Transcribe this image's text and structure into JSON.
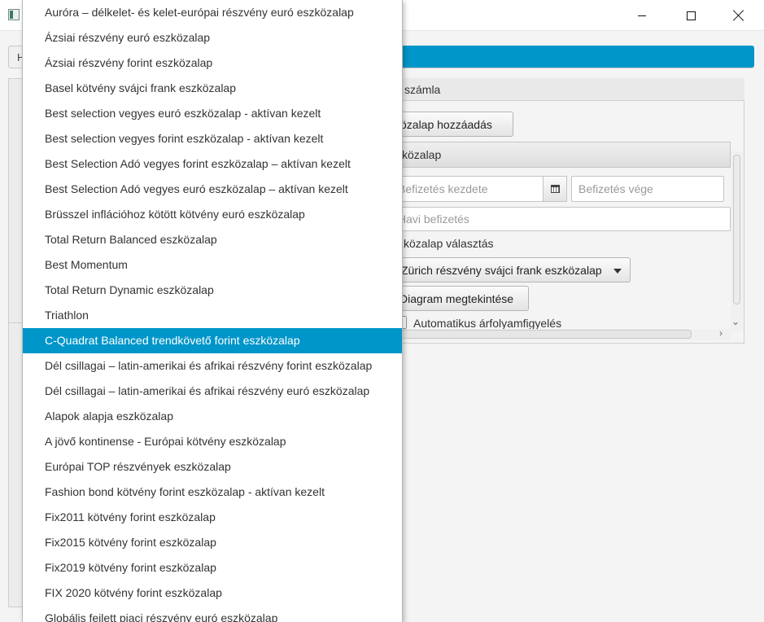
{
  "window": {
    "controls": {
      "minimize": "minimize-icon",
      "maximize": "maximize-icon",
      "close": "close-icon"
    }
  },
  "background": {
    "header_partial": "H",
    "tab_label": "számla",
    "add_fund_button": "közalap hozzáadás",
    "titled_pane": "zközalap",
    "payment_start_placeholder": "Befizetés kezdete",
    "payment_end_placeholder": "Befizetés vége",
    "monthly_payment_placeholder": "Havi befizetés",
    "fund_select_label": "zközalap választás",
    "fund_select_value": "Zürich részvény svájci frank eszközalap",
    "diagram_button": "Diagram megtekintése",
    "auto_watch_label": "Automatikus árfolyamfigyelés"
  },
  "colors": {
    "accent": "#0096c9"
  },
  "dropdown": {
    "selected_index": 13,
    "items": [
      "Auróra – délkelet- és kelet-európai részvény euró eszközalap",
      "Ázsiai részvény euró eszközalap",
      "Ázsiai részvény forint eszközalap",
      "Basel kötvény svájci frank eszközalap",
      "Best selection vegyes euró eszközalap - aktívan kezelt",
      "Best selection vegyes forint eszközalap - aktívan kezelt",
      "Best Selection Adó vegyes forint eszközalap – aktívan kezelt",
      "Best Selection Adó vegyes euró eszközalap – aktívan kezelt",
      "Brüsszel inflációhoz kötött kötvény euró eszközalap",
      "Total Return Balanced eszközalap",
      "Best Momentum",
      "Total Return Dynamic eszközalap",
      "Triathlon",
      "C-Quadrat Balanced trendkövető forint eszközalap",
      "Dél csillagai – latin-amerikai és afrikai részvény forint eszközalap",
      "Dél csillagai – latin-amerikai és afrikai részvény euró eszközalap",
      "Alapok alapja eszközalap",
      "A jövő kontinense - Európai kötvény eszközalap",
      "Európai TOP részvények eszközalap",
      "Fashion bond kötvény forint eszközalap - aktívan kezelt",
      "Fix2011 kötvény forint eszközalap",
      "Fix2015 kötvény forint eszközalap",
      "Fix2019 kötvény forint eszközalap",
      "FIX 2020 kötvény forint eszközalap",
      "Globális fejlett piaci részvény euró eszközalap"
    ]
  }
}
